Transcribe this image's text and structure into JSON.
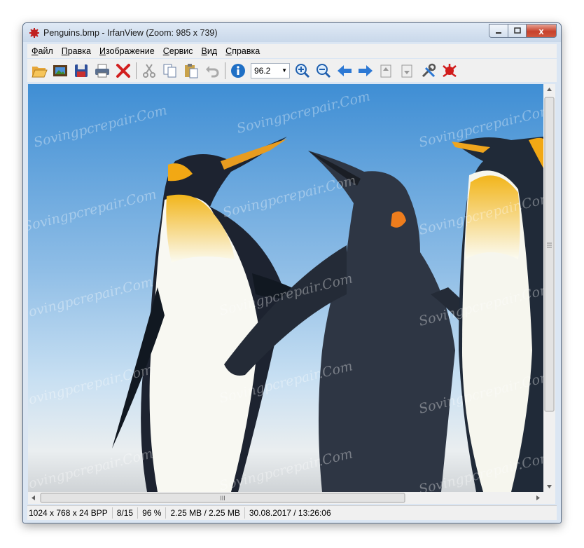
{
  "window": {
    "title": "Penguins.bmp - IrfanView (Zoom: 985 x 739)",
    "buttons": {
      "minimize": "─",
      "maximize": "▭",
      "close": "x"
    }
  },
  "menu": [
    {
      "label": "Файл",
      "accel": "Ф",
      "rest": "айл"
    },
    {
      "label": "Правка",
      "accel": "П",
      "rest": "равка"
    },
    {
      "label": "Изображение",
      "accel": "И",
      "rest": "зображение"
    },
    {
      "label": "Сервис",
      "accel": "С",
      "rest": "ервис"
    },
    {
      "label": "Вид",
      "accel": "В",
      "rest": "ид"
    },
    {
      "label": "Справка",
      "accel": "С",
      "rest": "правка"
    }
  ],
  "toolbar": {
    "zoom_value": "96.2",
    "icons": [
      "open-folder-icon",
      "slideshow-icon",
      "save-icon",
      "print-icon",
      "delete-icon",
      "cut-icon",
      "copy-icon",
      "paste-icon",
      "undo-icon",
      "info-icon",
      "zoom-in-icon",
      "zoom-out-icon",
      "previous-icon",
      "next-icon",
      "first-page-icon",
      "last-page-icon",
      "settings-icon",
      "irfanview-logo-icon"
    ]
  },
  "image": {
    "description_icon": "penguins-photo",
    "watermark": "Sovingpcrepair.Com"
  },
  "hscroll_grip": "III",
  "status": {
    "dimensions": "1024 x 768 x 24 BPP",
    "index": "8/15",
    "zoom": "96 %",
    "size": "2.25 MB / 2.25 MB",
    "datetime": "30.08.2017 / 13:26:06"
  },
  "colors": {
    "accent": "#1f6fc5",
    "close": "#c7412b"
  }
}
